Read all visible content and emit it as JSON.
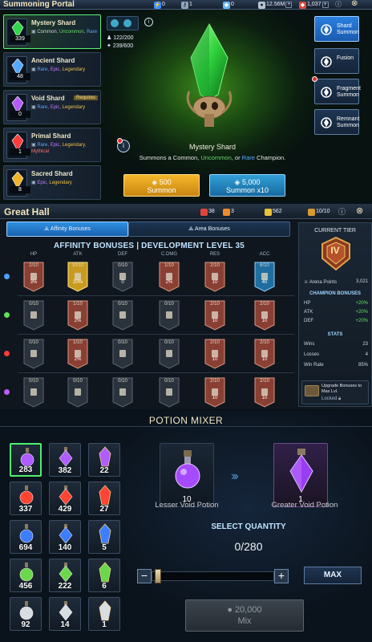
{
  "portal": {
    "title": "Summoning Portal",
    "resources": [
      {
        "name": "energy",
        "value": "0"
      },
      {
        "name": "silver-key",
        "value": "1"
      },
      {
        "name": "gem",
        "value": "0"
      },
      {
        "name": "silver",
        "value": "12.56M"
      },
      {
        "name": "gems",
        "value": "1,037"
      }
    ],
    "shards": [
      {
        "name": "Mystery Shard",
        "count": "339",
        "rarity": [
          "Common",
          "Uncommon",
          "Rare"
        ],
        "color": "#32d64a",
        "selected": true
      },
      {
        "name": "Ancient Shard",
        "count": "48",
        "rarity": [
          "Rare",
          "Epic",
          "Legendary"
        ],
        "color": "#55a8ff",
        "selected": false
      },
      {
        "name": "Void Shard",
        "count": "0",
        "rarity": [
          "Rare",
          "Epic",
          "Legendary"
        ],
        "color": "#b45cff",
        "selected": false,
        "tag": "Requires"
      },
      {
        "name": "Primal Shard",
        "count": "1",
        "rarity": [
          "Rare",
          "Epic",
          "Legendary",
          "Mythical"
        ],
        "color": "#ff3b3b",
        "selected": false
      },
      {
        "name": "Sacred Shard",
        "count": "8",
        "rarity": [
          "Epic",
          "Legendary"
        ],
        "color": "#f0b52a",
        "selected": false
      }
    ],
    "stats": {
      "pity": "122/200",
      "points": "239/600"
    },
    "selected_name": "Mystery Shard",
    "description_parts": [
      "Summons a Common, ",
      "Uncommon",
      ", or ",
      "Rare",
      " Champion."
    ],
    "side_buttons": [
      {
        "label": "Shard Summon",
        "active": true
      },
      {
        "label": "Fusion",
        "active": false
      },
      {
        "label": "Fragment Summon",
        "active": false
      },
      {
        "label": "Remnant Summon",
        "active": false
      }
    ],
    "summon_one": {
      "cost": "500",
      "label": "Summon"
    },
    "summon_ten": {
      "cost": "5,000",
      "label": "Summon x10"
    }
  },
  "hall": {
    "title": "Great Hall",
    "resources": [
      "38",
      "3",
      "562",
      "10/10"
    ],
    "tabs": [
      {
        "label": "Affinity Bonuses",
        "active": true
      },
      {
        "label": "Area Bonuses",
        "active": false
      }
    ],
    "heading": "AFFINITY BONUSES | DEVELOPMENT LEVEL 35",
    "columns": [
      "HP",
      "ATK",
      "DEF",
      "C.DMG",
      "RES",
      "ACC"
    ],
    "rows": [
      {
        "affinity": "Magic",
        "color": "#4aa3ff",
        "cells": [
          {
            "level": "2/10",
            "bonus": "3%",
            "style": "red"
          },
          {
            "level": "10/10",
            "bonus": "20%",
            "style": "gold"
          },
          {
            "level": "0/10",
            "bonus": "0",
            "style": "dark"
          },
          {
            "level": "1/10",
            "bonus": "2%",
            "style": "red"
          },
          {
            "level": "2/10",
            "bonus": "10",
            "style": "red"
          },
          {
            "level": "6/10",
            "bonus": "40",
            "style": "blue"
          }
        ]
      },
      {
        "affinity": "Force",
        "color": "#5fe05a",
        "cells": [
          {
            "level": "0/10",
            "bonus": "",
            "style": "dark"
          },
          {
            "level": "1/10",
            "bonus": "2%",
            "style": "red"
          },
          {
            "level": "0/10",
            "bonus": "",
            "style": "dark"
          },
          {
            "level": "0/10",
            "bonus": "",
            "style": "dark"
          },
          {
            "level": "2/10",
            "bonus": "10",
            "style": "red"
          },
          {
            "level": "2/10",
            "bonus": "10",
            "style": "red"
          }
        ]
      },
      {
        "affinity": "Spirit",
        "color": "#ff3b3b",
        "cells": [
          {
            "level": "0/10",
            "bonus": "",
            "style": "dark"
          },
          {
            "level": "1/10",
            "bonus": "2%",
            "style": "red"
          },
          {
            "level": "0/10",
            "bonus": "",
            "style": "dark"
          },
          {
            "level": "0/10",
            "bonus": "",
            "style": "dark"
          },
          {
            "level": "2/10",
            "bonus": "10",
            "style": "red"
          },
          {
            "level": "2/10",
            "bonus": "10",
            "style": "red"
          }
        ]
      },
      {
        "affinity": "Void",
        "color": "#c05cff",
        "cells": [
          {
            "level": "0/10",
            "bonus": "",
            "style": "dark"
          },
          {
            "level": "0/10",
            "bonus": "",
            "style": "dark"
          },
          {
            "level": "0/10",
            "bonus": "",
            "style": "dark"
          },
          {
            "level": "0/10",
            "bonus": "",
            "style": "dark"
          },
          {
            "level": "2/10",
            "bonus": "10",
            "style": "red"
          },
          {
            "level": "2/10",
            "bonus": "10",
            "style": "red"
          }
        ]
      }
    ],
    "tier": {
      "heading": "CURRENT TIER",
      "rank": "IV",
      "arena_points_label": "Arena Points",
      "arena_points": "3,021",
      "champ_heading": "CHAMPION BONUSES",
      "bonuses": [
        {
          "k": "HP",
          "v": "+20%"
        },
        {
          "k": "ATK",
          "v": "+20%"
        },
        {
          "k": "DEF",
          "v": "+20%"
        }
      ],
      "stats_heading": "STATS",
      "stats": [
        {
          "k": "Wins",
          "v": "23"
        },
        {
          "k": "Losses",
          "v": "4"
        },
        {
          "k": "Win Rate",
          "v": "85%"
        }
      ],
      "upgrade_text": "Upgrade Bonuses to Max Lvl.",
      "locked": "Locked"
    }
  },
  "mixer": {
    "title": "POTION MIXER",
    "grid": [
      {
        "count": "283",
        "color": "#b05cff",
        "selected": true
      },
      {
        "count": "382",
        "color": "#b05cff"
      },
      {
        "count": "22",
        "color": "#b05cff"
      },
      {
        "count": "337",
        "color": "#ff4433"
      },
      {
        "count": "429",
        "color": "#ff4433"
      },
      {
        "count": "27",
        "color": "#ff4433"
      },
      {
        "count": "694",
        "color": "#3d7dff"
      },
      {
        "count": "140",
        "color": "#3d7dff"
      },
      {
        "count": "5",
        "color": "#3d7dff"
      },
      {
        "count": "456",
        "color": "#6ad84a"
      },
      {
        "count": "222",
        "color": "#6ad84a"
      },
      {
        "count": "6",
        "color": "#6ad84a"
      },
      {
        "count": "92",
        "color": "#d8dde2"
      },
      {
        "count": "14",
        "color": "#d8dde2"
      },
      {
        "count": "1",
        "color": "#d8dde2"
      }
    ],
    "source": {
      "name": "Lesser Void Potion",
      "count": "10"
    },
    "target": {
      "name": "Greater Void Potion",
      "count": "1"
    },
    "quantity_label": "SELECT QUANTITY",
    "quantity": "0/280",
    "quantity_fraction": 0,
    "max_label": "MAX",
    "mix": {
      "cost": "20,000",
      "label": "Mix"
    }
  }
}
